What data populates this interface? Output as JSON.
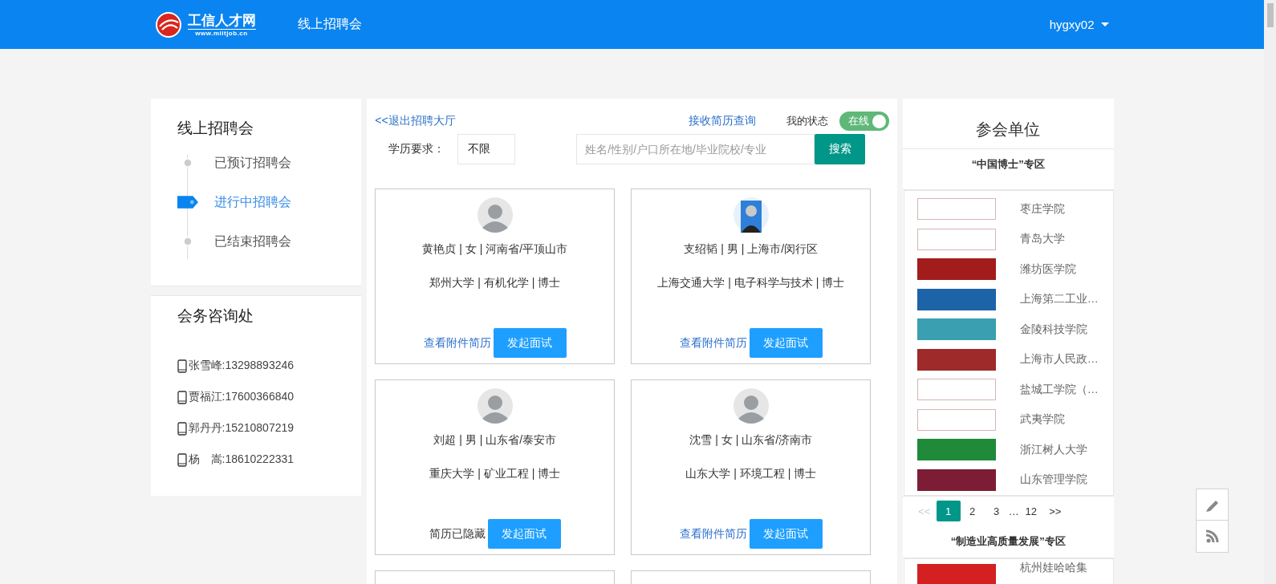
{
  "header": {
    "logo_title": "工信人才网",
    "logo_url": "www.miitjob.cn",
    "nav_title": "线上招聘会",
    "username": "hygxy02"
  },
  "sidebar": {
    "title": "线上招聘会",
    "steps": [
      {
        "label": "已预订招聘会",
        "selected": false
      },
      {
        "label": "进行中招聘会",
        "selected": true
      },
      {
        "label": "已结束招聘会",
        "selected": false
      }
    ],
    "contact_title": "会务咨询处",
    "contacts": [
      "张雪峰:13298893246",
      "贾福江:17600366840",
      "郭丹丹:15210807219",
      "杨　嵩:18610222331"
    ]
  },
  "main": {
    "exit_link": "<<退出招聘大厅",
    "resume_query_link": "接收简历查询",
    "status_label": "我的状态",
    "status_toggle": {
      "label": "在线",
      "on": true
    },
    "education_label": "学历要求：",
    "education_value": "不限",
    "search": {
      "placeholder": "姓名/性别/户口所在地/毕业院校/专业"
    },
    "search_button": "搜索",
    "candidates": [
      {
        "avatar": {
          "kind": "default"
        },
        "info": "黄艳贞 | 女 | 河南省/平顶山市",
        "education": "郑州大学 | 有机化学 | 博士",
        "resume": {
          "kind": "link",
          "text": "查看附件简历"
        },
        "action": "发起面试"
      },
      {
        "avatar": {
          "kind": "photo"
        },
        "info": "支绍韬 | 男 | 上海市/闵行区",
        "education": "上海交通大学 | 电子科学与技术 | 博士",
        "resume": {
          "kind": "link",
          "text": "查看附件简历"
        },
        "action": "发起面试"
      },
      {
        "avatar": {
          "kind": "default"
        },
        "info": "刘超 | 男 | 山东省/泰安市",
        "education": "重庆大学 | 矿业工程 | 博士",
        "resume": {
          "kind": "hidden",
          "text": "简历已隐藏"
        },
        "action": "发起面试"
      },
      {
        "avatar": {
          "kind": "default"
        },
        "info": "沈雪 | 女 | 山东省/济南市",
        "education": "山东大学 | 环境工程 | 博士",
        "resume": {
          "kind": "link",
          "text": "查看附件简历"
        },
        "action": "发起面试"
      }
    ]
  },
  "participants": {
    "title": "参会单位",
    "zones": [
      {
        "title": "“中国博士”专区",
        "units": [
          {
            "name": "枣庄学院",
            "color": "#ffffff"
          },
          {
            "name": "青岛大学",
            "color": "#ffffff"
          },
          {
            "name": "潍坊医学院",
            "color": "#a31c1c"
          },
          {
            "name": "上海第二工业…",
            "color": "#1d63a8"
          },
          {
            "name": "金陵科技学院",
            "color": "#3a9fb0"
          },
          {
            "name": "上海市人民政…",
            "color": "#9e2a2a"
          },
          {
            "name": "盐城工学院（…",
            "color": "#ffffff"
          },
          {
            "name": "武夷学院",
            "color": "#ffffff"
          },
          {
            "name": "浙江树人大学",
            "color": "#1e8a3a"
          },
          {
            "name": "山东管理学院",
            "color": "#7d1d35"
          }
        ],
        "pagination": {
          "prev": "<<",
          "prev_disabled": true,
          "pages": [
            {
              "label": "1",
              "selected": true
            },
            {
              "label": "2",
              "selected": false
            },
            {
              "label": "3",
              "selected": false
            }
          ],
          "ellipsis": "…",
          "last": {
            "label": "12",
            "selected": false
          },
          "next": ">>"
        }
      },
      {
        "title": "“制造业高质量发展”专区",
        "units": [
          {
            "name": "杭州娃哈哈集",
            "color": "#d42020"
          }
        ]
      }
    ]
  }
}
